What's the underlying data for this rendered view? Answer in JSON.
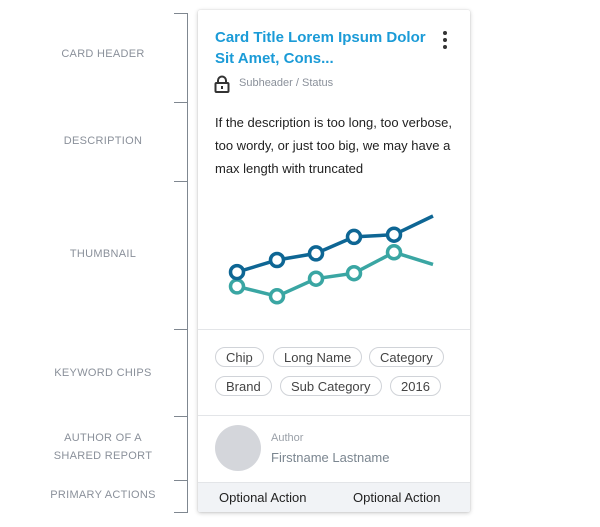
{
  "annotations": {
    "card_header": "CARD HEADER",
    "description": "DESCRIPTION",
    "thumbnail": "THUMBNAIL",
    "keyword_chips": "KEYWORD CHIPS",
    "author_line1": "AUTHOR OF A",
    "author_line2": "SHARED REPORT",
    "primary_actions": "PRIMARY ACTIONS"
  },
  "card": {
    "title": "Card Title Lorem Ipsum Dolor Sit Amet, Cons...",
    "subheader": "Subheader / Status",
    "description": "If the description is too long, too verbose, too wordy, or just too big, we may have a max length with truncated",
    "chips": [
      "Chip",
      "Long Name",
      "Category",
      "Brand",
      "Sub Category",
      "2016"
    ],
    "author": {
      "label": "Author",
      "name": "Firstname Lastname"
    },
    "actions": [
      "Optional Action",
      "Optional Action"
    ]
  },
  "thumbnail_chart": {
    "type": "line",
    "series": [
      {
        "color": "#0e6694",
        "values": [
          3.9,
          5.0,
          5.6,
          7.1,
          7.3,
          9.0
        ],
        "markers": [
          true,
          true,
          true,
          true,
          true,
          false
        ]
      },
      {
        "color": "#3aa6a3",
        "values": [
          2.6,
          1.7,
          3.3,
          3.8,
          5.7,
          4.6
        ],
        "markers": [
          true,
          true,
          true,
          true,
          true,
          false
        ]
      }
    ],
    "ylim": [
      0,
      10
    ],
    "icons": [
      "kebab-menu-icon",
      "lock-icon"
    ]
  }
}
